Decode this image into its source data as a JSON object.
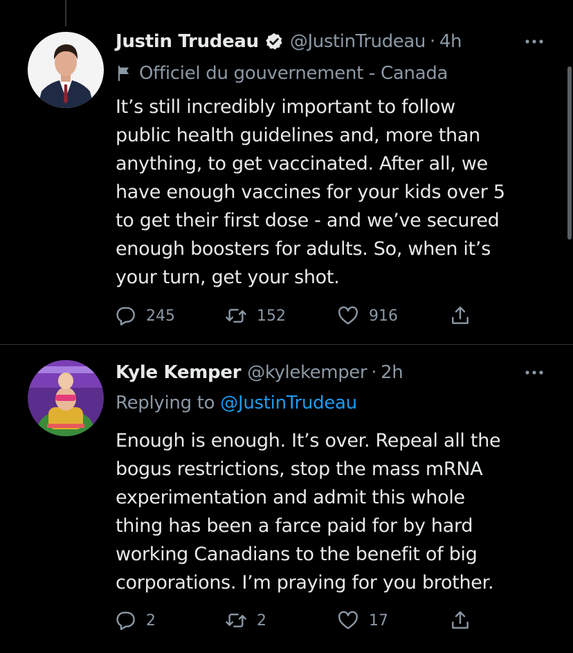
{
  "colors": {
    "background": "#000000",
    "text": "#e7e9ea",
    "secondary": "#8b98a5",
    "link": "#1d9bf0",
    "divider": "#2f3336"
  },
  "tweets": [
    {
      "name": "Justin Trudeau",
      "verified": true,
      "handle": "@JustinTrudeau",
      "separator": "·",
      "time": "4h",
      "label_icon": "flag-icon",
      "label": "Officiel du gouvernement - Canada",
      "text_lines": [
        "It’s still incredibly important to follow",
        "public health guidelines and, more than",
        "anything, to get vaccinated. After all, we",
        "have enough vaccines for your kids over 5",
        "to get their first dose - and we’ve secured",
        "enough boosters for adults. So, when it’s",
        "your turn, get your shot."
      ],
      "replies": "245",
      "retweets": "152",
      "likes": "916"
    },
    {
      "name": "Kyle Kemper",
      "verified": false,
      "handle": "@kylekemper",
      "separator": "·",
      "time": "2h",
      "replying_prefix": "Replying to",
      "replying_to": "@JustinTrudeau",
      "text_lines": [
        "Enough is enough. It’s over. Repeal all the",
        "bogus restrictions, stop the mass mRNA",
        "experimentation  and admit this whole",
        "thing has been a farce paid for by hard",
        "working Canadians to the benefit of big",
        "corporations. I’m praying for you brother."
      ],
      "replies": "2",
      "retweets": "2",
      "likes": "17"
    }
  ]
}
